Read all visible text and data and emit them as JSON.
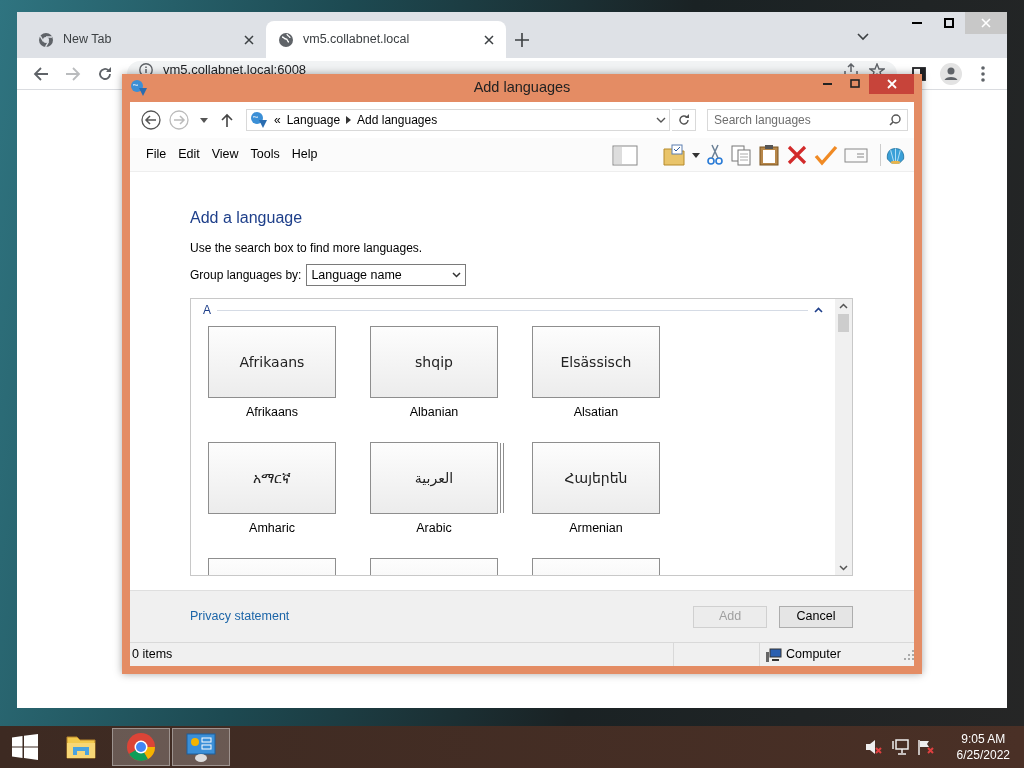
{
  "browser": {
    "tabs": [
      {
        "title": "New Tab",
        "selected": false
      },
      {
        "title": "vm5.collabnet.local",
        "selected": true
      }
    ],
    "address": "vm5.collabnet.local:6008"
  },
  "dialog": {
    "title": "Add languages",
    "breadcrumb": {
      "prefix": "«",
      "items": [
        "Language",
        "Add languages"
      ]
    },
    "search": {
      "placeholder": "Search languages"
    },
    "menu": [
      "File",
      "Edit",
      "View",
      "Tools",
      "Help"
    ],
    "heading": "Add a language",
    "hint": "Use the search box to find more languages.",
    "group_by": {
      "label": "Group languages by:",
      "value": "Language name"
    },
    "groups": [
      {
        "letter": "A",
        "expanded": true,
        "languages": [
          {
            "native": "Afrikaans",
            "name": "Afrikaans",
            "variants": false
          },
          {
            "native": "shqip",
            "name": "Albanian",
            "variants": false
          },
          {
            "native": "Elsässisch",
            "name": "Alsatian",
            "variants": false
          },
          {
            "native": "አማርኛ",
            "name": "Amharic",
            "variants": false
          },
          {
            "native": "العربية",
            "name": "Arabic",
            "variants": true
          },
          {
            "native": "Հայերեն",
            "name": "Armenian",
            "variants": false
          }
        ]
      }
    ],
    "privacy": "Privacy statement",
    "buttons": [
      {
        "label": "Add",
        "disabled": true
      },
      {
        "label": "Cancel",
        "disabled": false
      }
    ],
    "status": {
      "items": "0 items",
      "zone": "Computer"
    }
  },
  "taskbar": {
    "apps": [
      {
        "kind": "explorer",
        "selected": false
      },
      {
        "kind": "chrome",
        "selected": true
      },
      {
        "kind": "control-panel",
        "selected": true
      }
    ],
    "clock": {
      "time": "9:05 AM",
      "date": "6/25/2022"
    }
  }
}
